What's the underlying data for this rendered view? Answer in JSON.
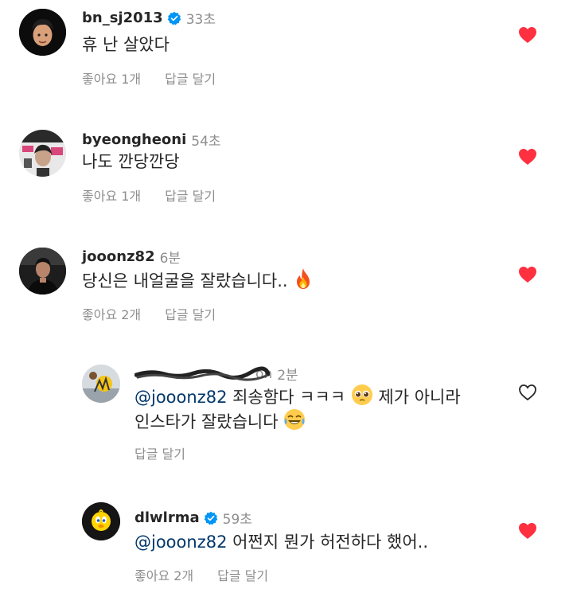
{
  "comments": [
    {
      "username": "bn_sj2013",
      "time": "33초",
      "text": "휴 난 살았다",
      "likes": "좋아요 1개",
      "reply": "답글 달기",
      "liked": true
    },
    {
      "username": "byeongheoni",
      "time": "54초",
      "text": "나도 깐당깐당",
      "likes": "좋아요 1개",
      "reply": "답글 달기",
      "liked": true
    },
    {
      "username": "jooonz82",
      "time": "6분",
      "text": "당신은 내얼굴을 잘랐습니다..",
      "likes": "좋아요 2개",
      "reply": "답글 달기",
      "liked": true
    }
  ],
  "replies": [
    {
      "username": "",
      "username_suffix": "on",
      "time": "2분",
      "mention": "@jooonz82",
      "text_line1": " 죄송함다 ㅋㅋㅋ ",
      "text_line1b": " 제가 아니라",
      "text_line2": "인스타가 잘랐습니다 ",
      "reply": "답글 달기",
      "liked": false
    },
    {
      "username": "dlwlrma",
      "time": "59초",
      "mention": "@jooonz82",
      "text": " 어쩐지 뭔가 허전하다 했어..",
      "likes": "좋아요 2개",
      "reply": "답글 달기",
      "liked": true
    }
  ],
  "colors": {
    "heart_red": "#ff3040",
    "verified_blue": "#0095f6",
    "mention_blue": "#00376b",
    "secondary_text": "#8e8e8e"
  }
}
